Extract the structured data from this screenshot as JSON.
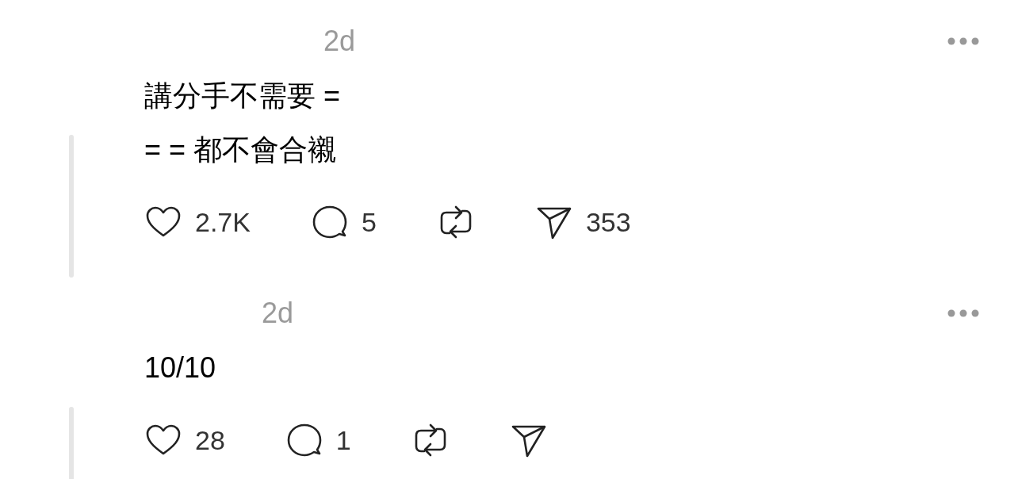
{
  "posts": [
    {
      "time": "2d",
      "text": "講分手不需要 =\n= = 都不會合襯",
      "likes": "2.7K",
      "replies": "5",
      "shares": "353"
    },
    {
      "time": "2d",
      "text": "10/10",
      "likes": "28",
      "replies": "1"
    }
  ]
}
